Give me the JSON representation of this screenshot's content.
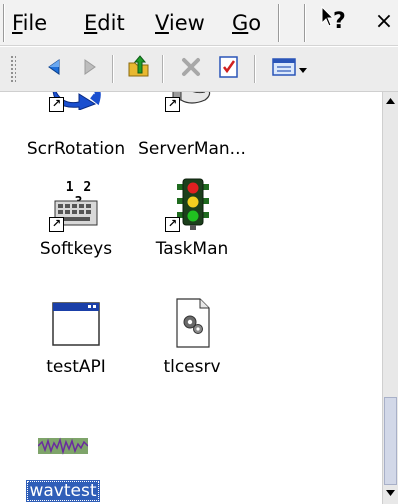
{
  "menu": {
    "file": {
      "pre": "",
      "key": "F",
      "post": "ile"
    },
    "edit": {
      "pre": "",
      "key": "E",
      "post": "dit"
    },
    "view": {
      "pre": "",
      "key": "V",
      "post": "iew"
    },
    "go": {
      "pre": "",
      "key": "G",
      "post": "o"
    },
    "help_label": "?",
    "close_label": "×"
  },
  "toolbar": {
    "buttons": [
      "back-icon",
      "forward-icon",
      "up-folder-icon",
      "delete-icon",
      "properties-icon",
      "views-icon"
    ]
  },
  "files": [
    {
      "name": "ScrRotation",
      "icon": "screen-rotation-icon",
      "shortcut": true,
      "selected": false
    },
    {
      "name": "ServerMan...",
      "icon": "server-manager-icon",
      "shortcut": true,
      "selected": false
    },
    {
      "name": "Softkeys",
      "icon": "softkeys-icon",
      "shortcut": true,
      "selected": false,
      "badge": "1 2 3"
    },
    {
      "name": "TaskMan",
      "icon": "traffic-light-icon",
      "shortcut": true,
      "selected": false
    },
    {
      "name": "testAPI",
      "icon": "application-window-icon",
      "shortcut": false,
      "selected": false
    },
    {
      "name": "tlcesrv",
      "icon": "system-file-icon",
      "shortcut": false,
      "selected": false
    },
    {
      "name": "wavtest",
      "icon": "waveform-icon",
      "shortcut": false,
      "selected": true
    }
  ],
  "colors": {
    "selection": "#2f5eb8",
    "menubar": "#f2f2f2",
    "toolbar": "#ececec"
  }
}
